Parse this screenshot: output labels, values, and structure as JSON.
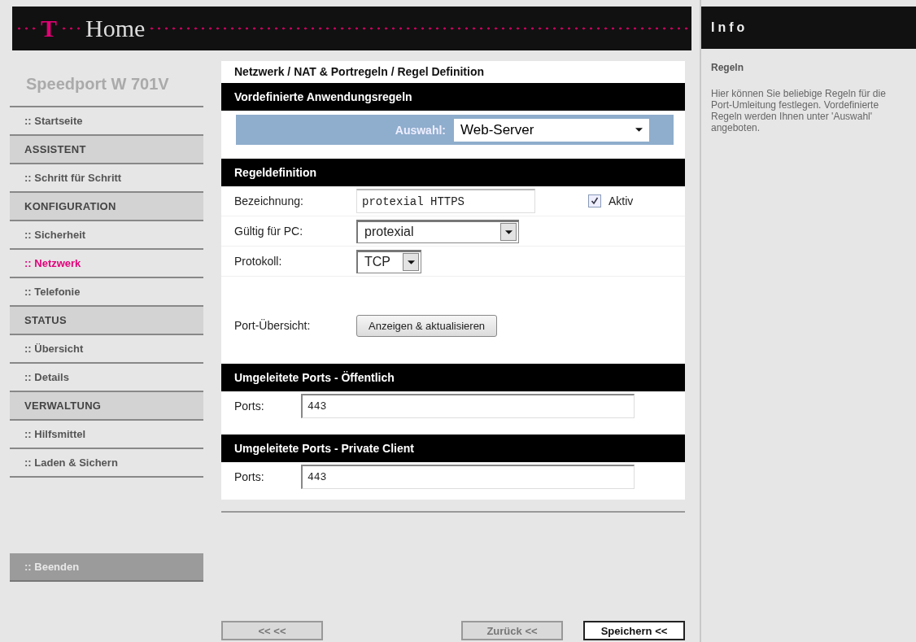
{
  "header": {
    "logo_mark": "T",
    "logo_text": "Home"
  },
  "sidebar": {
    "title": "Speedport W 701V",
    "items": [
      {
        "kind": "link",
        "label": ":: Startseite",
        "selected": false
      },
      {
        "kind": "group",
        "label": "ASSISTENT"
      },
      {
        "kind": "link",
        "label": ":: Schritt für Schritt",
        "selected": false
      },
      {
        "kind": "group",
        "label": "KONFIGURATION"
      },
      {
        "kind": "link",
        "label": ":: Sicherheit",
        "selected": false
      },
      {
        "kind": "link",
        "label": ":: Netzwerk",
        "selected": true
      },
      {
        "kind": "link",
        "label": ":: Telefonie",
        "selected": false
      },
      {
        "kind": "group",
        "label": "STATUS"
      },
      {
        "kind": "link",
        "label": ":: Übersicht",
        "selected": false
      },
      {
        "kind": "link",
        "label": ":: Details",
        "selected": false
      },
      {
        "kind": "group",
        "label": "VERWALTUNG"
      },
      {
        "kind": "link",
        "label": ":: Hilfsmittel",
        "selected": false
      },
      {
        "kind": "link",
        "label": ":: Laden & Sichern",
        "selected": false
      }
    ],
    "exit_button": ":: Beenden"
  },
  "breadcrumb": "Netzwerk / NAT & Portregeln / Regel Definition",
  "sections": [
    {
      "title": "Vordefinierte Anwendungsregeln",
      "selector": {
        "label": "Auswahl:",
        "value": "Web-Server"
      }
    },
    {
      "title": "Regeldefinition",
      "rows": [
        {
          "kind": "text",
          "label": "Bezeichnung:",
          "value": "protexial HTTPS",
          "checkbox": {
            "label": "Aktiv",
            "checked": true
          }
        },
        {
          "kind": "select",
          "label": "Gültig für PC:",
          "value": "protexial"
        },
        {
          "kind": "select",
          "label": "Protokoll:",
          "value": "TCP"
        },
        {
          "kind": "button",
          "label": "Port-Übersicht:",
          "value": "Anzeigen & aktualisieren"
        }
      ]
    },
    {
      "title": "Umgeleitete Ports - Öffentlich",
      "rows": [
        {
          "kind": "ports",
          "label": "Ports:",
          "value": "443"
        }
      ]
    },
    {
      "title": "Umgeleitete Ports - Private Client",
      "rows": [
        {
          "kind": "ports",
          "label": "Ports:",
          "value": "443"
        }
      ]
    }
  ],
  "footer_buttons": [
    {
      "label": "<< <<",
      "disabled": true
    },
    {
      "label": "Zurück <<",
      "disabled": true
    },
    {
      "label": "Speichern <<",
      "disabled": false
    }
  ],
  "info": {
    "title": "Info",
    "heading": "Regeln",
    "text": "Hier können Sie beliebige Regeln für die Port-Umleitung festlegen. Vordefinierte Regeln werden Ihnen unter 'Auswahl' angeboten."
  }
}
